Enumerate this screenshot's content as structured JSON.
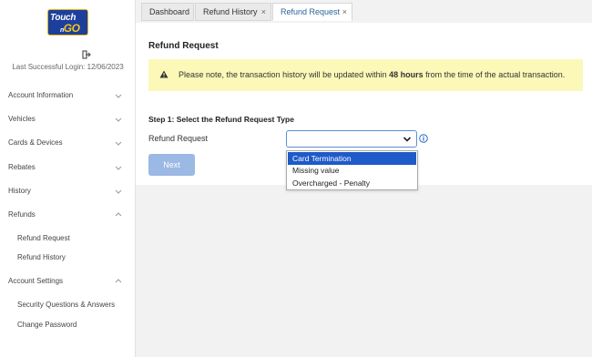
{
  "brand": {
    "line1": "Touch",
    "line2": "GO",
    "line2_prefix": "n"
  },
  "sidebar": {
    "last_login": "Last Successful Login: 12/06/2023",
    "items": [
      {
        "label": "Account Information"
      },
      {
        "label": "Vehicles"
      },
      {
        "label": "Cards & Devices"
      },
      {
        "label": "Rebates"
      },
      {
        "label": "History"
      },
      {
        "label": "Refunds"
      },
      {
        "label": "Refund Request"
      },
      {
        "label": "Refund History"
      },
      {
        "label": "Account Settings"
      },
      {
        "label": "Security Questions & Answers"
      },
      {
        "label": "Change Password"
      }
    ]
  },
  "tabs": [
    {
      "label": "Dashboard"
    },
    {
      "label": "Refund History",
      "close": "×"
    },
    {
      "label": "Refund Request",
      "close": "×"
    }
  ],
  "main": {
    "title": "Refund Request",
    "alert_pre": "Please note, the transaction history will be updated within ",
    "alert_bold": "48 hours",
    "alert_post": " from the time of the actual transaction.",
    "step_title": "Step 1: Select the Refund Request Type",
    "field_label": "Refund Request",
    "select_value": "",
    "next_label": "Next",
    "options": [
      {
        "label": "Card Termination"
      },
      {
        "label": "Missing value"
      },
      {
        "label": "Overcharged - Penalty"
      }
    ]
  },
  "colors": {
    "accent": "#1e5ac8",
    "alert_bg": "#fcf8b8",
    "button": "#9cb8e4"
  }
}
